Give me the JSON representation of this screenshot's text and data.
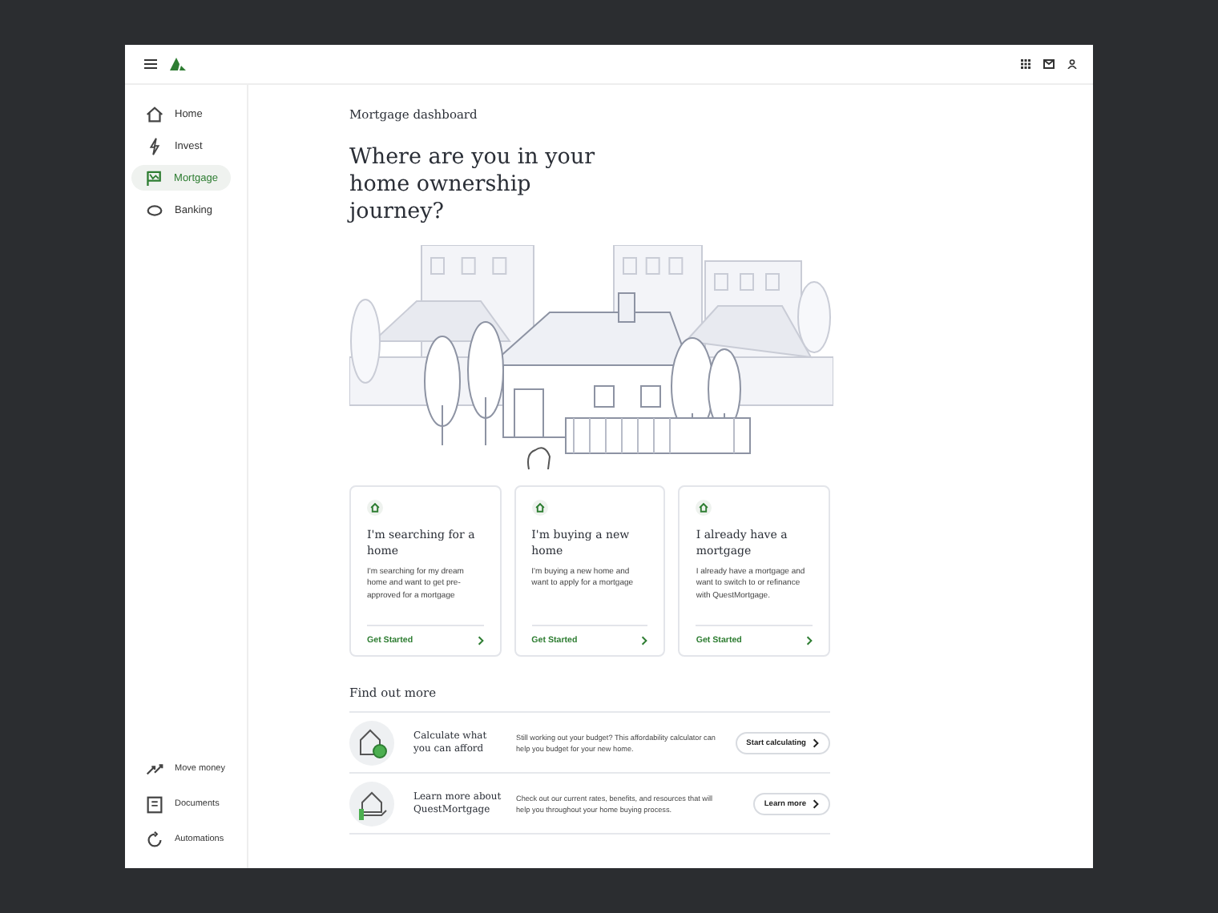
{
  "sidebar": {
    "items": [
      {
        "label": "Home",
        "selected": false
      },
      {
        "label": "Invest",
        "selected": false
      },
      {
        "label": "Mortgage",
        "selected": true
      },
      {
        "label": "Banking",
        "selected": false
      }
    ],
    "bottom_items": [
      {
        "label": "Move money"
      },
      {
        "label": "Documents"
      },
      {
        "label": "Automations"
      }
    ]
  },
  "breadcrumb": "Mortgage dashboard",
  "heading": "Where are you in your home ownership journey?",
  "cards": [
    {
      "title": "I'm searching for a home",
      "text": "I'm searching for my dream home and want to get pre-approved for a mortgage",
      "action": "Get Started"
    },
    {
      "title": "I'm buying a new home",
      "text": "I'm buying a new home and want to apply for a mortgage",
      "action": "Get Started"
    },
    {
      "title": "I already have a mortgage",
      "text": "I already have a mortgage and want to switch to or refinance with QuestMortgage.",
      "action": "Get Started"
    }
  ],
  "find_out_more": {
    "title": "Find out more",
    "rows": [
      {
        "kind": "calculator",
        "title": "Calculate what you can afford",
        "text": "Still working out your budget? This affordability calculator can help you budget for your new home.",
        "button": "Start calculating"
      },
      {
        "kind": "info",
        "title": "Learn more about QuestMortgage",
        "text": "Check out our current rates, benefits, and resources that will help you throughout your home buying process.",
        "button": "Learn more"
      }
    ]
  }
}
